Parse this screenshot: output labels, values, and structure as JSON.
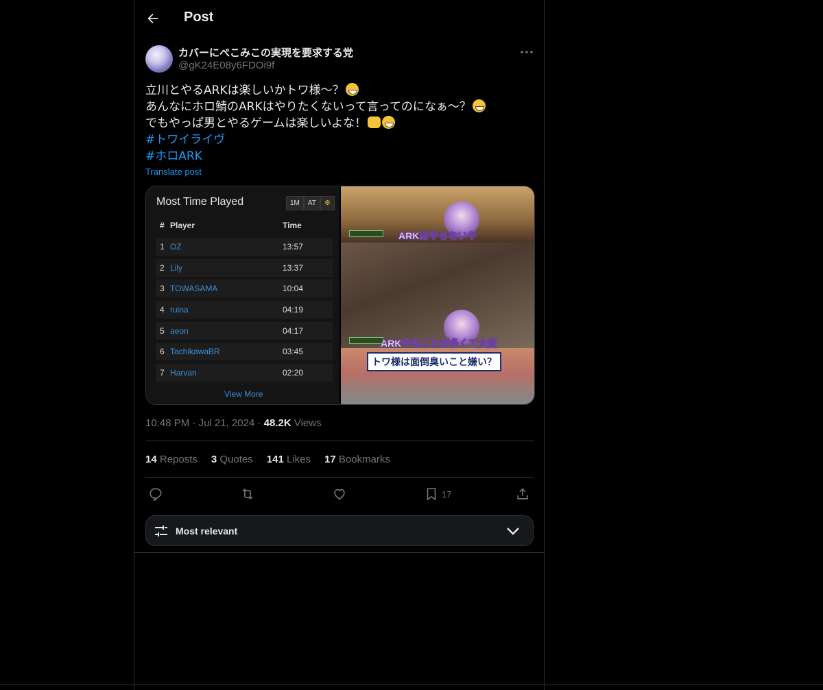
{
  "header": {
    "title": "Post"
  },
  "author": {
    "display_name": "カバーにぺこみこの実現を要求する党",
    "handle": "@gK24E08y6FDOi9f"
  },
  "post": {
    "line1": "立川とやるARKは楽しいかトワ様〜？",
    "line2": "あんなにホロ鯖のARKはやりたくないって言ってのになぁ〜？",
    "line3": "でもやっぱ男とやるゲームは楽しいよな！",
    "hashtag1": "#トワイライヴ",
    "hashtag2": "#ホロARK",
    "translate": "Translate post"
  },
  "leaderboard": {
    "title": "Most Time Played",
    "buttons": [
      "1M",
      "AT",
      "⚙"
    ],
    "col_rank": "#",
    "col_player": "Player",
    "col_time": "Time",
    "rows": [
      {
        "rank": "1",
        "player": "OZ",
        "time": "13:57"
      },
      {
        "rank": "2",
        "player": "Lily",
        "time": "13:37"
      },
      {
        "rank": "3",
        "player": "TOWASAMA",
        "time": "10:04"
      },
      {
        "rank": "4",
        "player": "ruina",
        "time": "04:19"
      },
      {
        "rank": "5",
        "player": "aeon",
        "time": "04:17"
      },
      {
        "rank": "6",
        "player": "TachikawaBR",
        "time": "03:45"
      },
      {
        "rank": "7",
        "player": "Harvan",
        "time": "02:20"
      }
    ],
    "view_more": "View More"
  },
  "video": {
    "subtitle1": "ARKはやらないや",
    "subtitle2": "ARKやることが多くて大変",
    "caption": "トワ様は面倒臭いこと嫌い？"
  },
  "meta": {
    "time": "10:48 PM",
    "dot": "·",
    "date": "Jul 21, 2024",
    "views_count": "48.2K",
    "views_label": "Views"
  },
  "stats": {
    "reposts_count": "14",
    "reposts_label": "Reposts",
    "quotes_count": "3",
    "quotes_label": "Quotes",
    "likes_count": "141",
    "likes_label": "Likes",
    "bookmarks_count": "17",
    "bookmarks_label": "Bookmarks"
  },
  "actions": {
    "bookmark_count": "17"
  },
  "sort": {
    "label": "Most relevant"
  },
  "colors": {
    "accent": "#1d9bf0",
    "muted": "#71767b",
    "border": "#2f3336"
  }
}
